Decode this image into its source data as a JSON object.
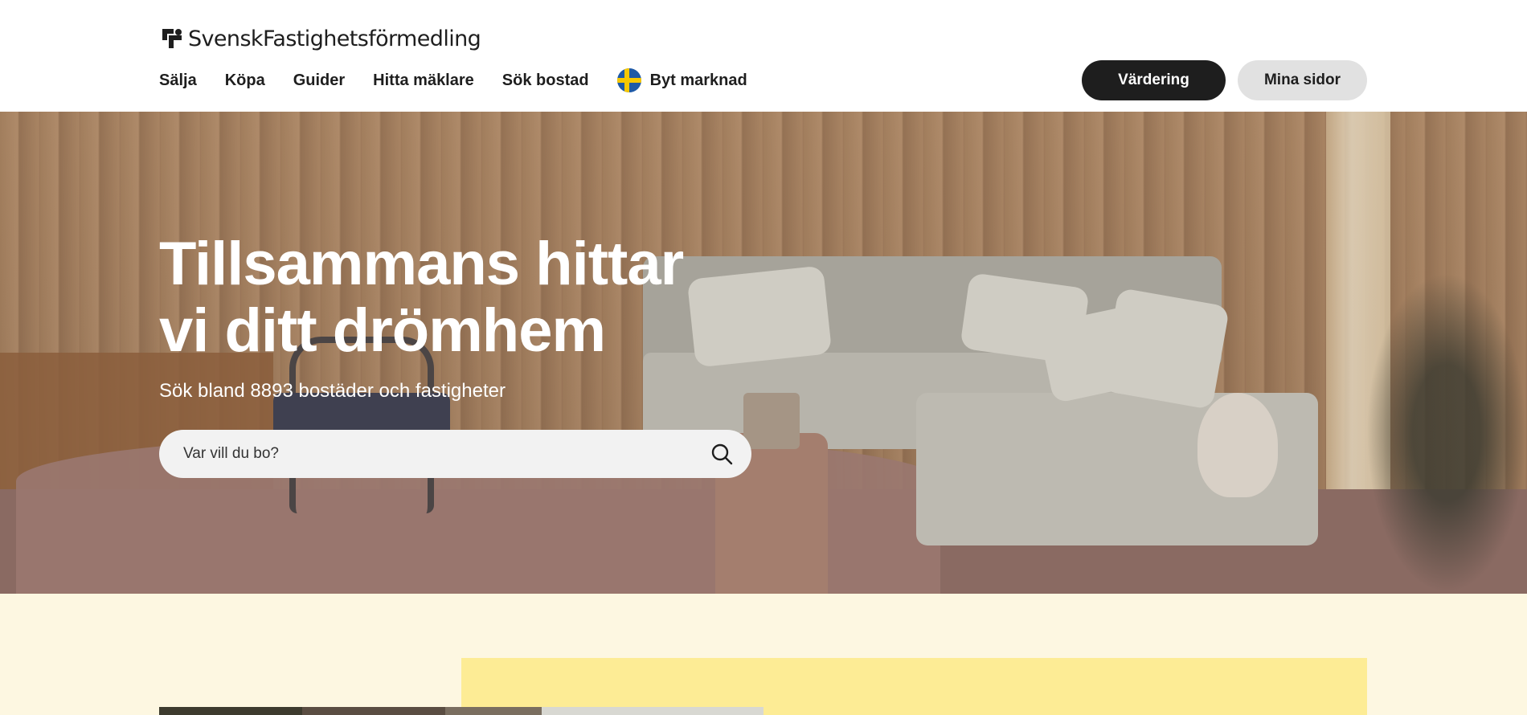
{
  "brand": {
    "name": "SvenskFastighetsförmedling"
  },
  "nav": {
    "items": [
      {
        "label": "Sälja"
      },
      {
        "label": "Köpa"
      },
      {
        "label": "Guider"
      },
      {
        "label": "Hitta mäklare"
      },
      {
        "label": "Sök bostad"
      },
      {
        "label": "Byt marknad",
        "icon": "swedish-flag-icon"
      }
    ]
  },
  "actions": {
    "primary_label": "Värdering",
    "secondary_label": "Mina sidor"
  },
  "hero": {
    "title_line1": "Tillsammans hittar",
    "title_line2": "vi ditt drömhem",
    "subtitle": "Sök bland 8893 bostäder och fastigheter"
  },
  "search": {
    "placeholder": "Var vill du bo?",
    "value": "",
    "icon": "search-icon"
  },
  "colors": {
    "primary_button": "#1e1e1e",
    "secondary_button": "#e1e1e1",
    "bottom_background": "#fdf7e1",
    "yellow_panel": "#fdec95"
  }
}
